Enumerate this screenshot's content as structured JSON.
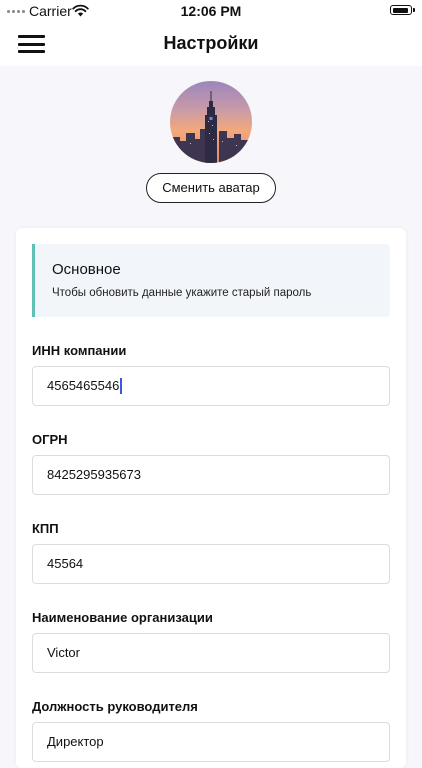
{
  "status_bar": {
    "carrier": "Carrier",
    "time": "12:06 PM"
  },
  "nav": {
    "title": "Настройки",
    "menu_icon": "hamburger-menu-icon"
  },
  "profile": {
    "change_avatar_label": "Сменить аватар"
  },
  "info": {
    "title": "Основное",
    "subtitle": "Чтобы обновить данные укажите старый пароль",
    "accent_color": "#5fc1b4"
  },
  "fields": [
    {
      "label": "ИНН компании",
      "value": "4565465546",
      "focused": true
    },
    {
      "label": "ОГРН",
      "value": "8425295935673"
    },
    {
      "label": "КПП",
      "value": "45564"
    },
    {
      "label": "Наименование организации",
      "value": "Victor"
    },
    {
      "label": "Должность руководителя",
      "value": "Директор"
    }
  ]
}
